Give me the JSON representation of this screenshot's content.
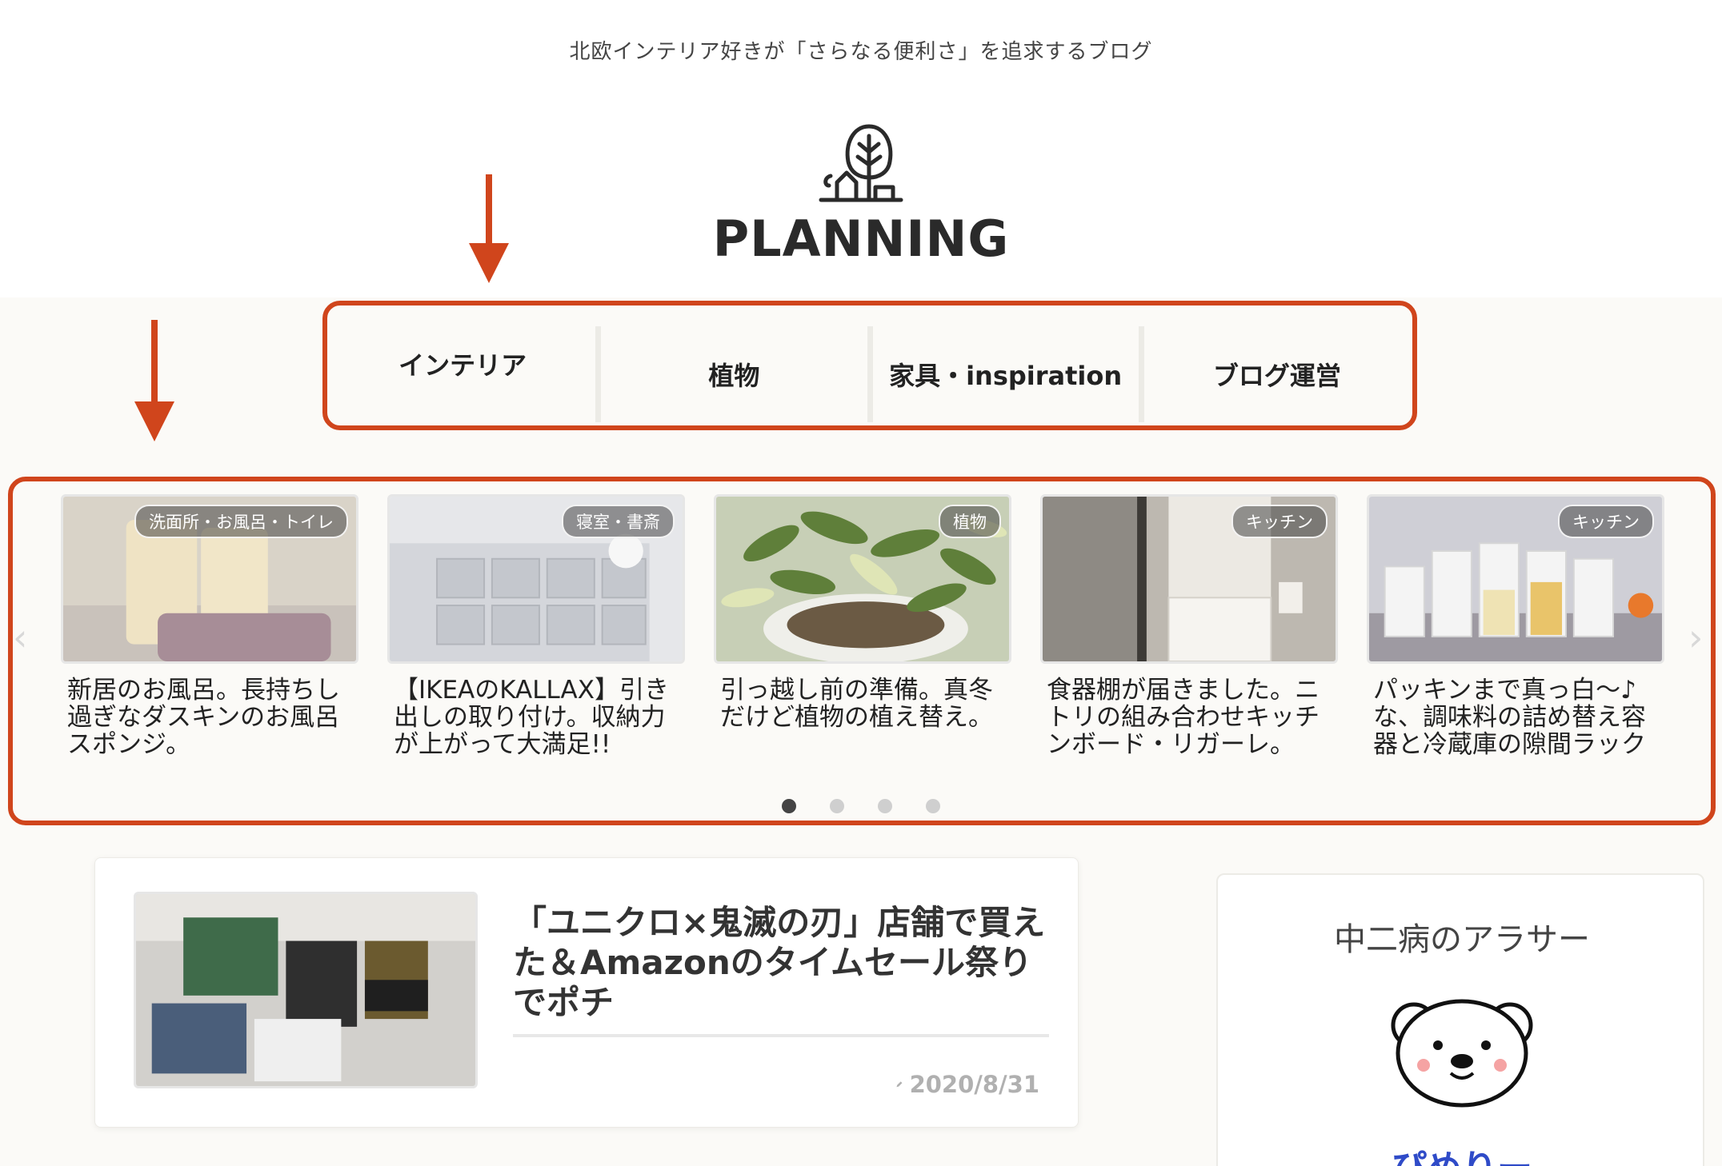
{
  "header": {
    "tagline": "北欧インテリア好きが「さらなる便利さ」を追求するブログ",
    "logo_text": "PLANNING",
    "logo_icon": "tree-house-icon"
  },
  "nav": {
    "items": [
      {
        "label": "インテリア"
      },
      {
        "label": "植物"
      },
      {
        "label": "家具・inspiration"
      },
      {
        "label": "ブログ運営"
      }
    ]
  },
  "carousel": {
    "prev_icon": "chevron-left-icon",
    "next_icon": "chevron-right-icon",
    "slides": [
      {
        "category": "洗面所・お風呂・トイレ",
        "title": "新居のお風呂。長持ちし過ぎなダスキンのお風呂スポンジ。"
      },
      {
        "category": "寝室・書斎",
        "title": "【IKEAのKALLAX】引き出しの取り付け。収納力が上がって大満足!!"
      },
      {
        "category": "植物",
        "title": "引っ越し前の準備。真冬だけど植物の植え替え。"
      },
      {
        "category": "キッチン",
        "title": "食器棚が届きました。ニトリの組み合わせキッチンボード・リガーレ。"
      },
      {
        "category": "キッチン",
        "title": "パッキンまで真っ白〜♪な、調味料の詰め替え容器と冷蔵庫の隙間ラック"
      }
    ],
    "page_count": 4,
    "active_page": 1
  },
  "article": {
    "title": "「ユニクロ×鬼滅の刃」店舗で買えた＆Amazonのタイムセール祭りでポチ",
    "date": "2020/8/31",
    "date_icon": "pencil-icon"
  },
  "profile": {
    "title": "中二病のアラサー",
    "name": "ぴめりー",
    "avatar_icon": "bear-avatar-icon"
  },
  "colors": {
    "highlight": "#d0451c",
    "background": "#fbfaf7",
    "profile_name": "#2f4bc8"
  }
}
